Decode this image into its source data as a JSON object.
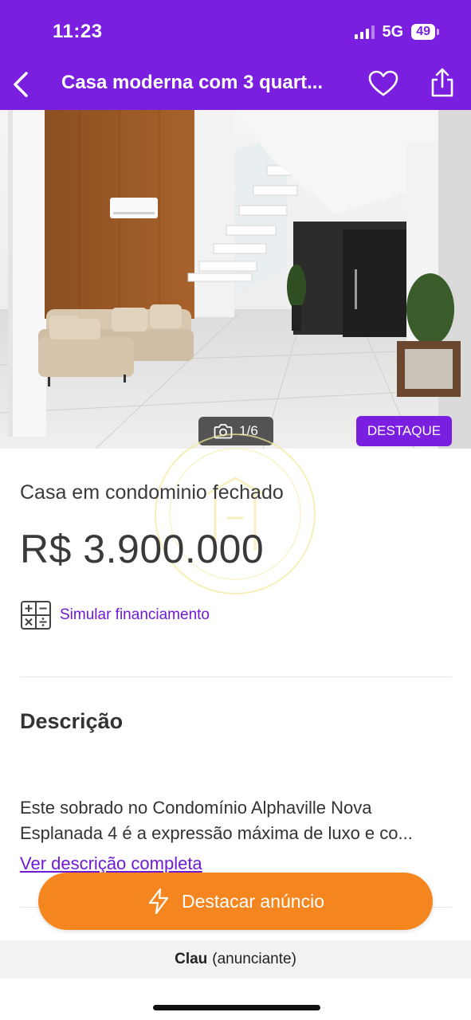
{
  "status_bar": {
    "time": "11:23",
    "network": "5G",
    "battery": "49"
  },
  "header": {
    "title": "Casa moderna com 3 quart...",
    "back_icon": "chevron-left-icon",
    "favorite_icon": "heart-icon",
    "share_icon": "share-icon",
    "background_color": "#7a1ee0"
  },
  "gallery": {
    "counter": "1/6",
    "counter_icon": "camera-icon",
    "badge": "DESTAQUE"
  },
  "listing": {
    "property_type": "Casa em condominio fechado",
    "price": "R$ 3.900.000",
    "finance_icon": "calculator-icon",
    "finance_link": "Simular financiamento"
  },
  "description": {
    "heading": "Descrição",
    "line1": "Este sobrado no Condomínio Alphaville Nova",
    "line2": "Esplanada 4 é a expressão máxima de luxo e co...",
    "see_more": "Ver descrição completa"
  },
  "cta": {
    "label": "Destacar anúncio",
    "icon": "lightning-icon",
    "color": "#f5861f"
  },
  "advertiser": {
    "name": "Clau",
    "role": "(anunciante)"
  }
}
